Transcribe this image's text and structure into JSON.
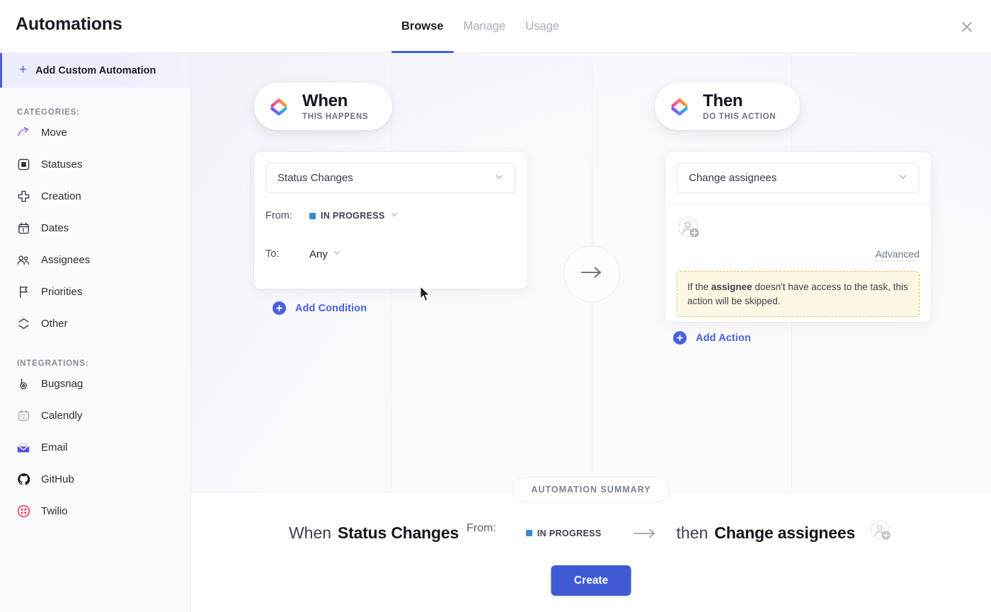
{
  "header": {
    "title": "Automations",
    "tabs": [
      {
        "label": "Browse",
        "active": true
      },
      {
        "label": "Manage",
        "active": false
      },
      {
        "label": "Usage",
        "active": false
      }
    ],
    "close_icon": "close-icon"
  },
  "sidebar": {
    "add_custom": {
      "label": "Add Custom Automation",
      "icon": "plus-icon"
    },
    "categories_label": "CATEGORIES:",
    "categories": [
      {
        "label": "Move",
        "icon": "arrow-move-icon"
      },
      {
        "label": "Statuses",
        "icon": "status-square-icon"
      },
      {
        "label": "Creation",
        "icon": "plus-cross-icon"
      },
      {
        "label": "Dates",
        "icon": "calendar-icon"
      },
      {
        "label": "Assignees",
        "icon": "people-icon"
      },
      {
        "label": "Priorities",
        "icon": "flag-icon"
      },
      {
        "label": "Other",
        "icon": "layers-icon"
      }
    ],
    "integrations_label": "INTEGRATIONS:",
    "integrations": [
      {
        "label": "Bugsnag",
        "icon": "bugsnag-icon"
      },
      {
        "label": "Calendly",
        "icon": "calendly-icon"
      },
      {
        "label": "Email",
        "icon": "email-icon"
      },
      {
        "label": "GitHub",
        "icon": "github-icon"
      },
      {
        "label": "Twilio",
        "icon": "twilio-icon"
      }
    ]
  },
  "builder": {
    "when": {
      "pill_title": "When",
      "pill_subtitle": "THIS HAPPENS",
      "trigger_value": "Status Changes",
      "conditions": [
        {
          "label": "From:",
          "value": "IN PROGRESS",
          "swatch_color": "#3d85d8",
          "has_swatch": true
        },
        {
          "label": "To:",
          "value": "Any",
          "has_swatch": false
        }
      ],
      "add_condition_label": "Add Condition"
    },
    "connector_icon": "arrow-right-icon",
    "then": {
      "pill_title": "Then",
      "pill_subtitle": "DO THIS ACTION",
      "action_value": "Change assignees",
      "assignee_placeholder_icon": "add-assignee-avatar-icon",
      "advanced_label": "Advanced",
      "warning_prefix": "If the ",
      "warning_bold": "assignee",
      "warning_suffix": " doesn't have access to the task, this action will be skipped.",
      "add_action_label": "Add Action"
    }
  },
  "summary": {
    "pill_label": "AUTOMATION SUMMARY",
    "when_word": "When",
    "trigger": "Status Changes",
    "from_label": "From:",
    "status": "IN PROGRESS",
    "status_color": "#3d85d8",
    "arrow_icon": "arrow-right-icon",
    "then_word": "then",
    "action": "Change assignees",
    "avatar_icon": "add-assignee-avatar-icon",
    "create_label": "Create"
  },
  "colors": {
    "accent_blue": "#4a60e0",
    "create_button": "#3f5ad4",
    "warning_bg": "#fdf8e3",
    "warning_border": "#e8bf5a"
  }
}
